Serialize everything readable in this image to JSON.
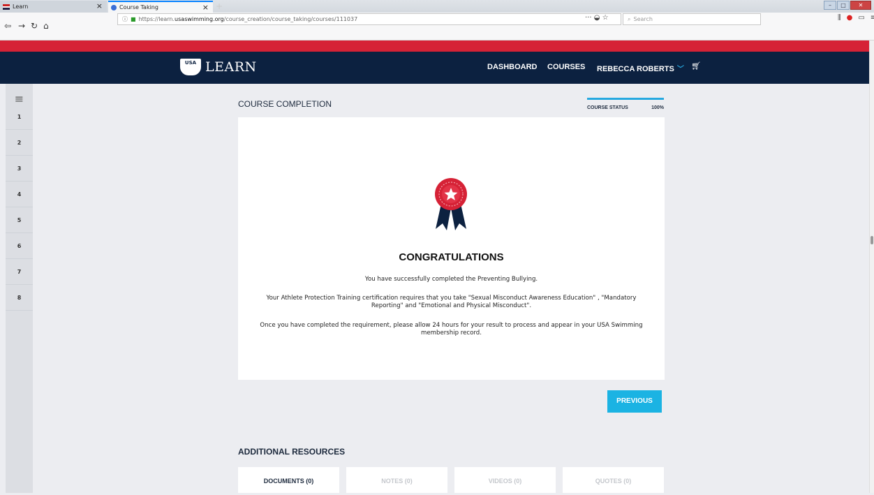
{
  "browser": {
    "tabs": [
      {
        "label": "Learn"
      },
      {
        "label": "Course Taking"
      }
    ],
    "url_prefix": "https://learn.",
    "url_host": "usaswimming.org",
    "url_path": "/course_creation/course_taking/courses/111037",
    "search_placeholder": "Search"
  },
  "header": {
    "logo_text": "LEARN",
    "shield_text": "USA",
    "nav": {
      "dashboard": "DASHBOARD",
      "courses": "COURSES",
      "user": "REBECCA ROBERTS"
    }
  },
  "sidebar": {
    "items": [
      "1",
      "2",
      "3",
      "4",
      "5",
      "6",
      "7",
      "8"
    ]
  },
  "main": {
    "title": "COURSE COMPLETION",
    "status_label": "COURSE STATUS",
    "status_value": "100%",
    "congrats": "CONGRATULATIONS",
    "message1": "You have successfully completed the Preventing Bullying.",
    "message2": "Your Athlete Protection Training certification requires that you take \"Sexual Misconduct Awareness Education\" , \"Mandatory Reporting\" and \"Emotional and Physical Misconduct\".",
    "message3": "Once you have completed the requirement, please allow 24 hours for your result to process and appear in your USA Swimming membership record.",
    "previous_label": "PREVIOUS",
    "resources_title": "ADDITIONAL RESOURCES",
    "resource_tabs": [
      "DOCUMENTS (0)",
      "NOTES (0)",
      "VIDEOS (0)",
      "QUOTES (0)"
    ]
  },
  "colors": {
    "navy": "#0c2140",
    "red": "#d62236",
    "accent": "#1bb3e3"
  }
}
